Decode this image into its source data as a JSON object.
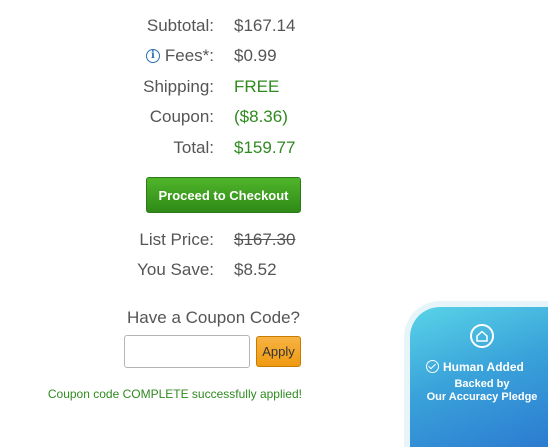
{
  "summary": {
    "subtotal": {
      "label": "Subtotal:",
      "value": "$167.14"
    },
    "fees": {
      "label": "Fees*:",
      "value": "$0.99",
      "icon": "info-icon"
    },
    "shipping": {
      "label": "Shipping:",
      "value": "FREE"
    },
    "coupon": {
      "label": "Coupon:",
      "value": "($8.36)"
    },
    "total": {
      "label": "Total:",
      "value": "$159.77"
    }
  },
  "checkout": {
    "label": "Proceed to Checkout"
  },
  "pricing": {
    "list_price": {
      "label": "List Price:",
      "value": "$167.30"
    },
    "you_save": {
      "label": "You Save:",
      "value": "$8.52"
    }
  },
  "coupon_form": {
    "heading": "Have a Coupon Code?",
    "input_value": "",
    "apply_label": "Apply",
    "message": "Coupon code COMPLETE successfully applied!"
  },
  "badge": {
    "title": "Human Added",
    "subtitle_line1": "Backed by",
    "subtitle_line2": "Our Accuracy Pledge",
    "icon": "house-icon"
  },
  "colors": {
    "green_text": "#2f8a1f",
    "checkout_button": "#3a9d1f",
    "apply_button": "#f2a227",
    "badge_gradient_start": "#59d4e8",
    "badge_gradient_end": "#2b78d0",
    "info_icon": "#2b6fb3"
  }
}
